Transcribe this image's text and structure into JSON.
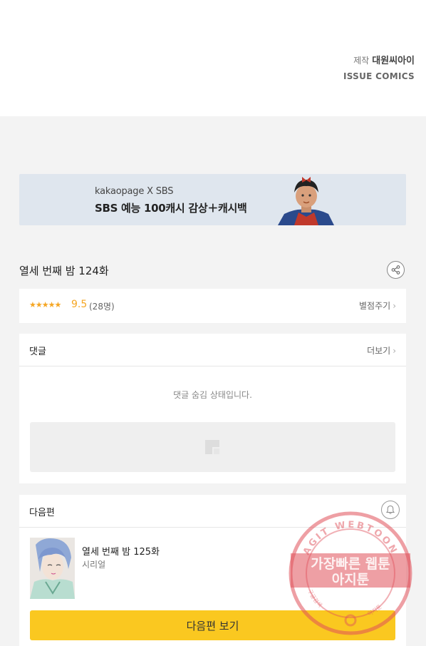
{
  "credits": {
    "label": "제작",
    "studio": "대원씨아이",
    "publisher": "ISSUE COMICS"
  },
  "banner": {
    "subtitle": "kakaopage X SBS",
    "title": "SBS 예능 100캐시 감상＋캐시백"
  },
  "episode": {
    "title": "열세 번째 밤 124화"
  },
  "rating": {
    "stars": "★★★★★",
    "score": "9.5",
    "count": "(28명)",
    "action": "별점주기"
  },
  "comments": {
    "title": "댓글",
    "more": "더보기",
    "hidden_message": "댓글 숨김 상태입니다."
  },
  "next": {
    "section_title": "다음편",
    "episode_title": "열세 번째 밤 125화",
    "category": "시리얼",
    "button": "다음편 보기"
  },
  "watermark": {
    "line1": "가장빠른 웹툰",
    "line2": "아지툰",
    "ring_top": "AGIT WEBTOON",
    "ring_bottom_left": "구글검색",
    "ring_bottom_right": "아지툰"
  },
  "colors": {
    "accent": "#f5a623",
    "button": "#fac820",
    "watermark": "#e0505a"
  }
}
